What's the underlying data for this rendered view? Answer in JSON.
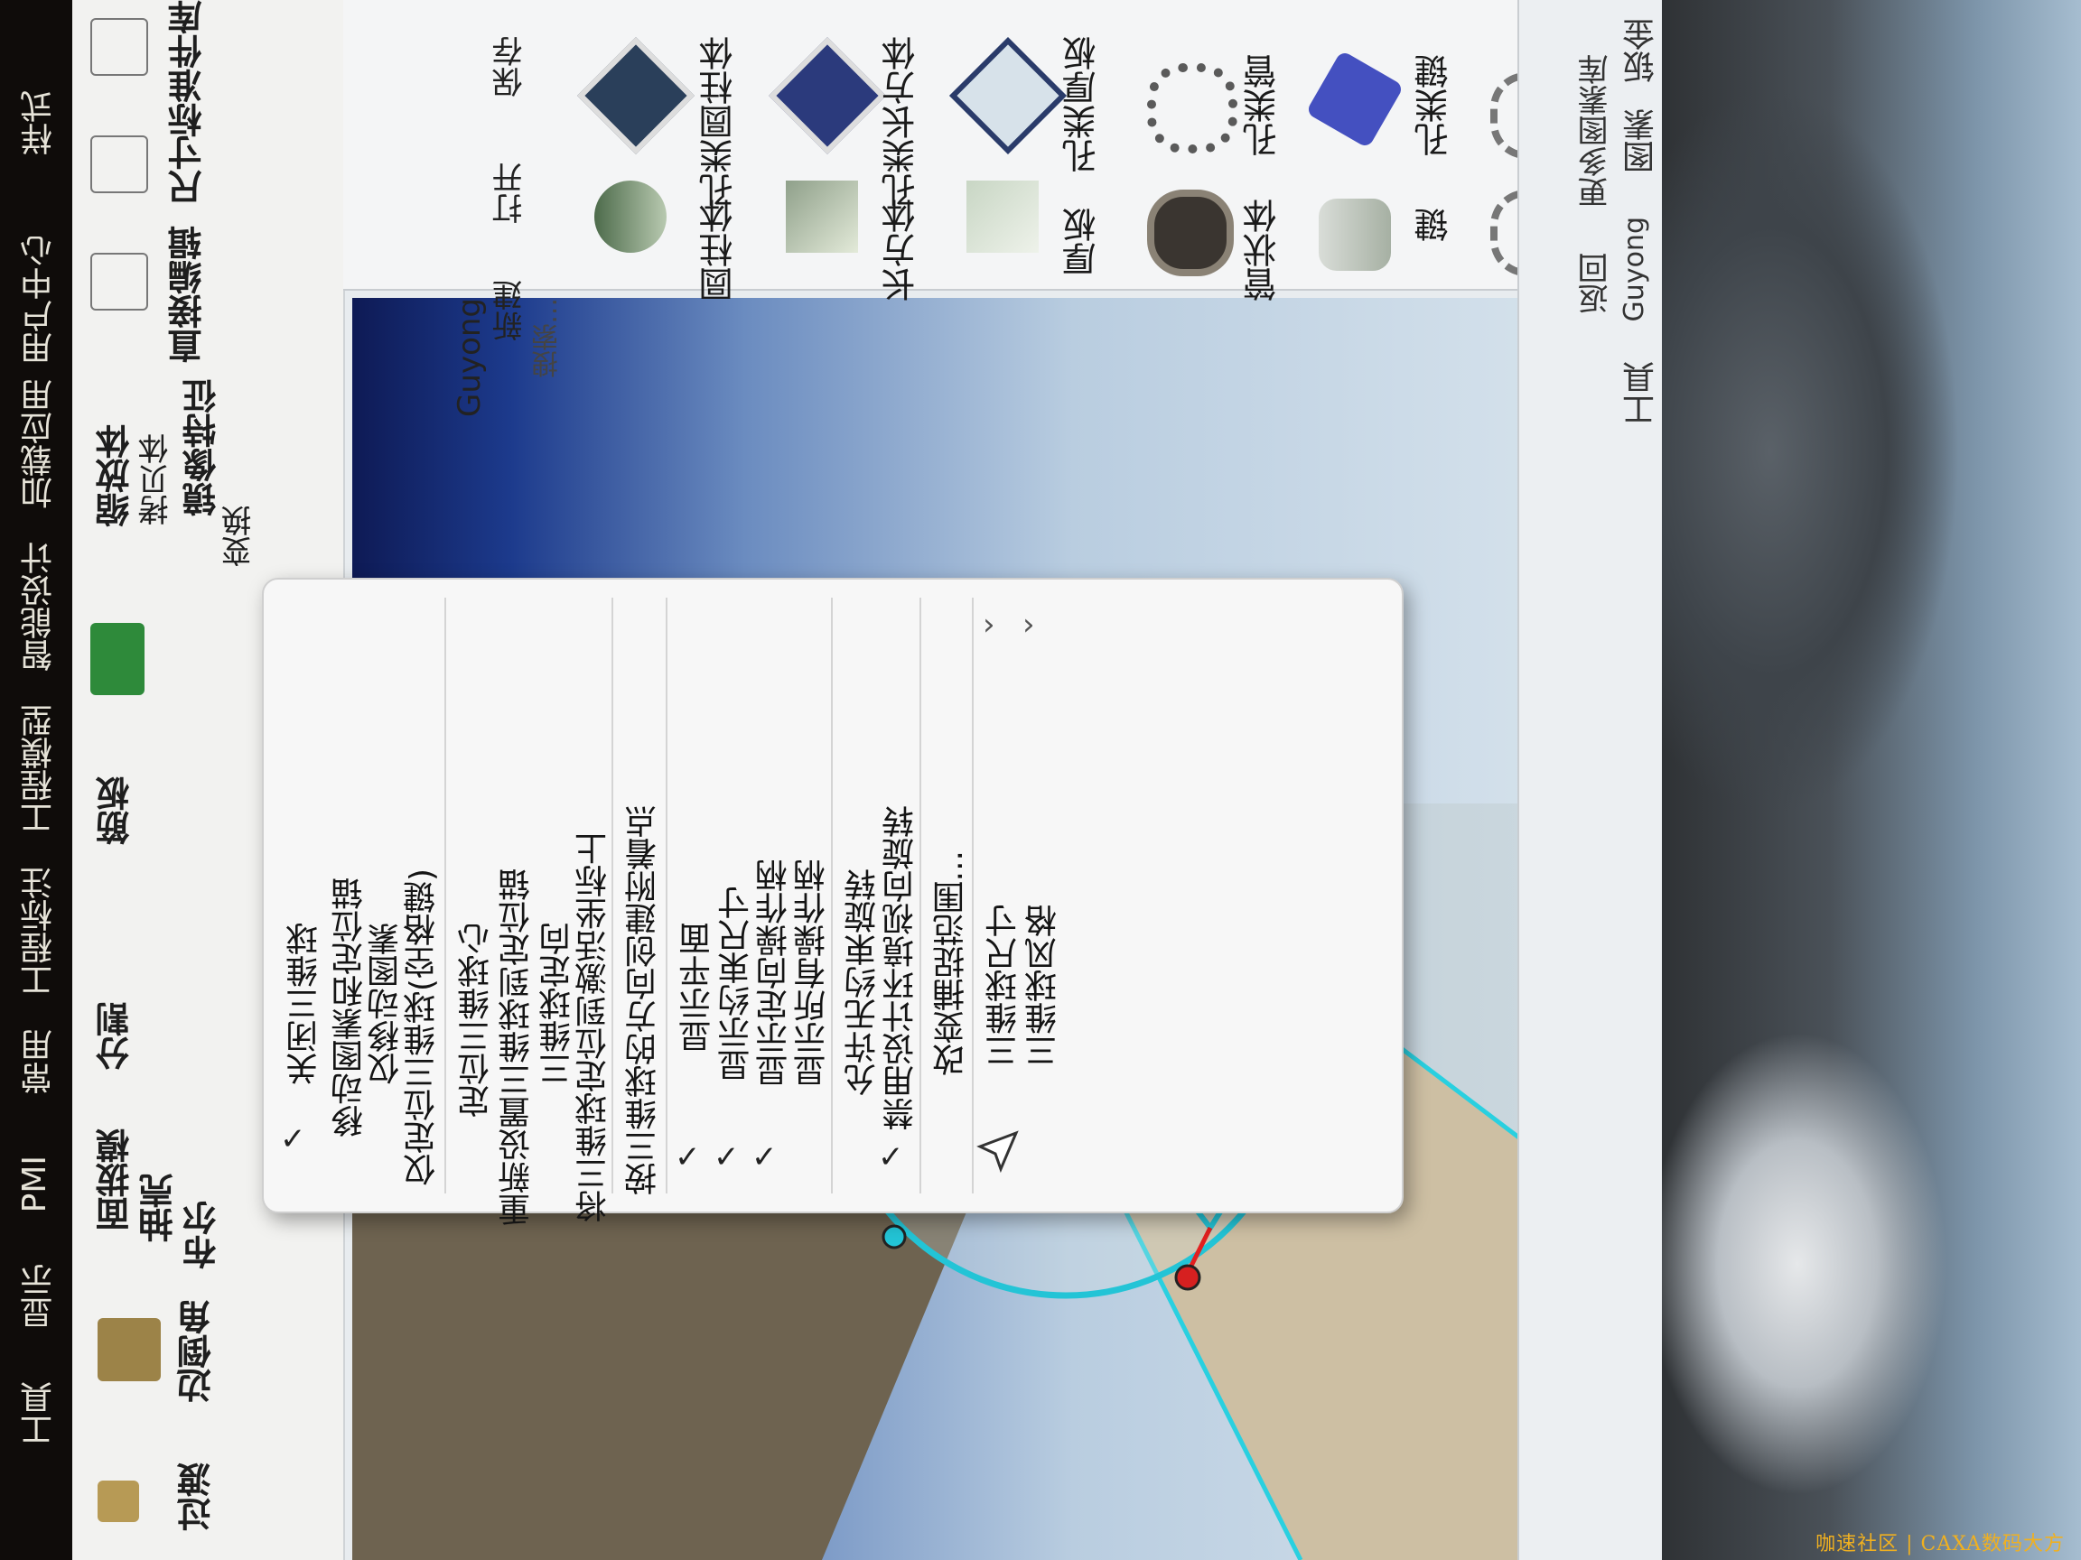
{
  "menu_bar": {
    "items": [
      "工具",
      "显示",
      "PMI",
      "常用",
      "工程标注",
      "工程模型",
      "智能设计",
      "加载应用",
      "用户中心",
      "样式"
    ]
  },
  "ribbon": {
    "buttons": {
      "transition": "过渡",
      "fillet": "边倒角",
      "face_draft": "面拔模",
      "shell": "抽壳",
      "boolean": "布尔",
      "split": "分割",
      "rib": "筋板",
      "scale": "缩放体",
      "copy": "拷贝体",
      "mirror": "镜像特征",
      "transform": "变换",
      "direct_edit": "直接编辑",
      "dimension": "尺寸",
      "standard_parts": "标准件库"
    }
  },
  "design_library": {
    "title": "Guyong",
    "toolbar": {
      "new": "新建",
      "open": "打开",
      "save": "保存"
    },
    "search_placeholder": "搜索...",
    "items": [
      {
        "label": "圆柱体"
      },
      {
        "label": "孔类圆柱体"
      },
      {
        "label": "长方体"
      },
      {
        "label": "孔类长方体"
      },
      {
        "label": "厚板"
      },
      {
        "label": "孔类厚板"
      },
      {
        "label": "管状体"
      },
      {
        "label": "孔类管"
      },
      {
        "label": "键"
      },
      {
        "label": "孔类键"
      }
    ],
    "nav": {
      "back": "返回",
      "more": "更多图素库"
    },
    "tabs": [
      "工具",
      "Guyong",
      "图素",
      "钣金"
    ]
  },
  "context_menu": {
    "items": [
      {
        "label": "关闭三维球",
        "checked": false
      },
      {
        "label": "移动图素和定位锚",
        "checked": true
      },
      {
        "label": "仅移动图素",
        "checked": false
      },
      {
        "label": "仅定位三维球(空格键)",
        "checked": false
      },
      {
        "label": "定位三维球心",
        "checked": false
      },
      {
        "label": "重新设置三维球到定位锚",
        "checked": false
      },
      {
        "label": "三维球定向",
        "checked": false
      },
      {
        "label": "将三维球定位到激活坐标上",
        "checked": false
      },
      {
        "label": "按三维球的方向创建附着点",
        "checked": false
      },
      {
        "label": "显示平面",
        "checked": true
      },
      {
        "label": "显示约束尺寸",
        "checked": true
      },
      {
        "label": "显示定向操作柄",
        "checked": true
      },
      {
        "label": "显示所有操作柄",
        "checked": false
      },
      {
        "label": "允许无约束旋转",
        "checked": false
      },
      {
        "label": "禁用设计环境视向旋转",
        "checked": true
      },
      {
        "label": "改变捕捉范围...",
        "checked": false
      },
      {
        "label": "三维球尺寸",
        "submenu": true
      },
      {
        "label": "三维球风格",
        "submenu": true
      }
    ]
  },
  "watermark": "咖速社区 | CAXA数码大方",
  "colors": {
    "ball_cyan": "#23c4d6",
    "menu_bg": "#f7f7f7",
    "viewport_dark": "#0e1a55"
  }
}
